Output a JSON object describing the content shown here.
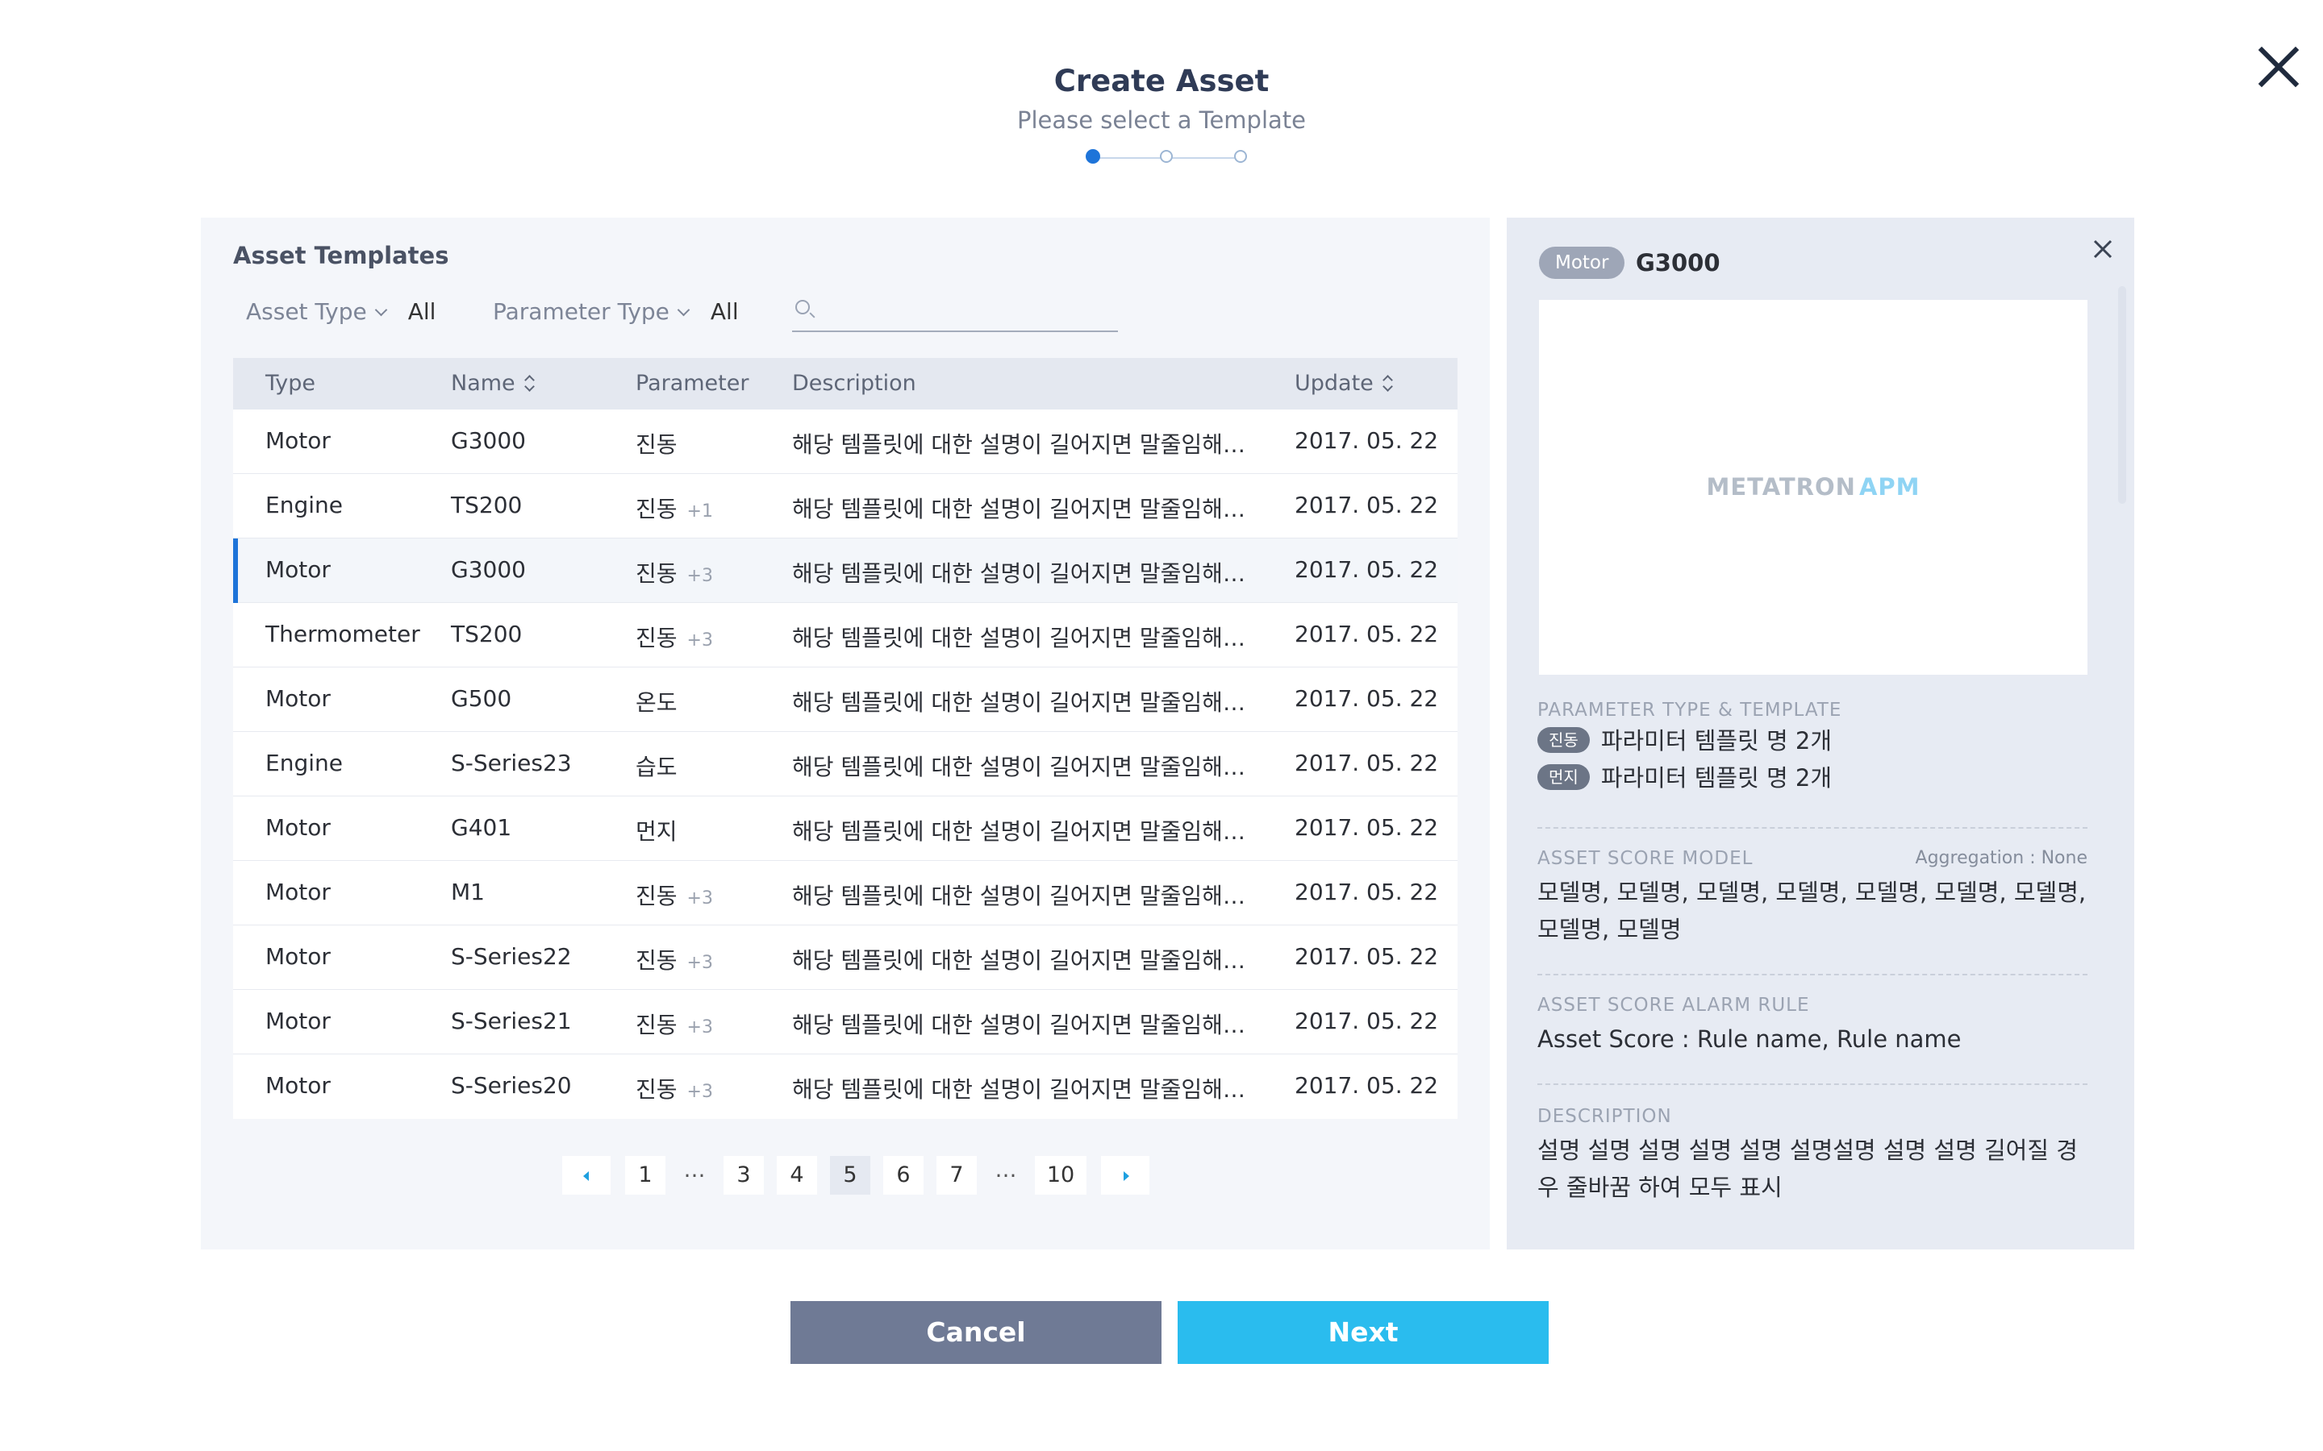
{
  "header": {
    "title": "Create Asset",
    "subtitle": "Please select a Template",
    "steps_total": 3,
    "current_step": 1
  },
  "templates": {
    "title": "Asset Templates",
    "filters": {
      "asset_type": {
        "label": "Asset Type",
        "value": "All"
      },
      "parameter_type": {
        "label": "Parameter Type",
        "value": "All"
      },
      "search_value": ""
    },
    "columns": {
      "type": "Type",
      "name": "Name",
      "parameter": "Parameter",
      "description": "Description",
      "update": "Update"
    },
    "rows": [
      {
        "type": "Motor",
        "name": "G3000",
        "parameter": "진동",
        "extra": "",
        "description": "해당 템플릿에 대한 설명이 길어지면 말줄임해주세요",
        "update": "2017. 05. 22"
      },
      {
        "type": "Engine",
        "name": "TS200",
        "parameter": "진동",
        "extra": "+1",
        "description": "해당 템플릿에 대한 설명이 길어지면 말줄임해주세요",
        "update": "2017. 05. 22"
      },
      {
        "type": "Motor",
        "name": "G3000",
        "parameter": "진동",
        "extra": "+3",
        "description": "해당 템플릿에 대한 설명이 길어지면 말줄임해주세요",
        "update": "2017. 05. 22"
      },
      {
        "type": "Thermometer",
        "name": "TS200",
        "parameter": "진동",
        "extra": "+3",
        "description": "해당 템플릿에 대한 설명이 길어지면 말줄임해주세요",
        "update": "2017. 05. 22"
      },
      {
        "type": "Motor",
        "name": "G500",
        "parameter": "온도",
        "extra": "",
        "description": "해당 템플릿에 대한 설명이 길어지면 말줄임해주세요",
        "update": "2017. 05. 22"
      },
      {
        "type": "Engine",
        "name": "S-Series23",
        "parameter": "습도",
        "extra": "",
        "description": "해당 템플릿에 대한 설명이 길어지면 말줄임해주세요",
        "update": "2017. 05. 22"
      },
      {
        "type": "Motor",
        "name": "G401",
        "parameter": "먼지",
        "extra": "",
        "description": "해당 템플릿에 대한 설명이 길어지면 말줄임해주세요",
        "update": "2017. 05. 22"
      },
      {
        "type": "Motor",
        "name": "M1",
        "parameter": "진동",
        "extra": "+3",
        "description": "해당 템플릿에 대한 설명이 길어지면 말줄임해주세요",
        "update": "2017. 05. 22"
      },
      {
        "type": "Motor",
        "name": "S-Series22",
        "parameter": "진동",
        "extra": "+3",
        "description": "해당 템플릿에 대한 설명이 길어지면 말줄임해주세요",
        "update": "2017. 05. 22"
      },
      {
        "type": "Motor",
        "name": "S-Series21",
        "parameter": "진동",
        "extra": "+3",
        "description": "해당 템플릿에 대한 설명이 길어지면 말줄임해주세요",
        "update": "2017. 05. 22"
      },
      {
        "type": "Motor",
        "name": "S-Series20",
        "parameter": "진동",
        "extra": "+3",
        "description": "해당 템플릿에 대한 설명이 길어지면 말줄임해주세요",
        "update": "2017. 05. 22"
      }
    ],
    "selected_row": 2,
    "pagination": {
      "pages": [
        "1",
        "…",
        "3",
        "4",
        "5",
        "6",
        "7",
        "…",
        "10"
      ],
      "current": "5"
    }
  },
  "detail": {
    "type_badge": "Motor",
    "name": "G3000",
    "preview_logo": {
      "part1": "METATRON",
      "part2": "APM"
    },
    "parameter_section": {
      "label": "PARAMETER TYPE & TEMPLATE",
      "items": [
        {
          "tag": "진동",
          "text": "파라미터 템플릿 명 2개"
        },
        {
          "tag": "먼지",
          "text": "파라미터 템플릿 명 2개"
        }
      ]
    },
    "score_model": {
      "label": "ASSET SCORE MODEL",
      "aggregation": "Aggregation : None",
      "text": "모델명, 모델명, 모델명, 모델명, 모델명, 모델명, 모델명, 모델명, 모델명"
    },
    "alarm_rule": {
      "label": "ASSET SCORE ALARM RULE",
      "text": "Asset Score : Rule name, Rule name"
    },
    "description": {
      "label": "DESCRIPTION",
      "text": "설명 설명 설명 설명 설명 설명설명 설명 설명 길어질 경우 줄바꿈 하여 모두 표시"
    }
  },
  "footer": {
    "cancel_label": "Cancel",
    "next_label": "Next"
  },
  "colors": {
    "accent_blue": "#1e74d9",
    "next_button": "#2abcee",
    "cancel_button": "#6f7a95",
    "panel_bg": "#f4f6fa",
    "detail_bg": "#e7ebf3"
  }
}
